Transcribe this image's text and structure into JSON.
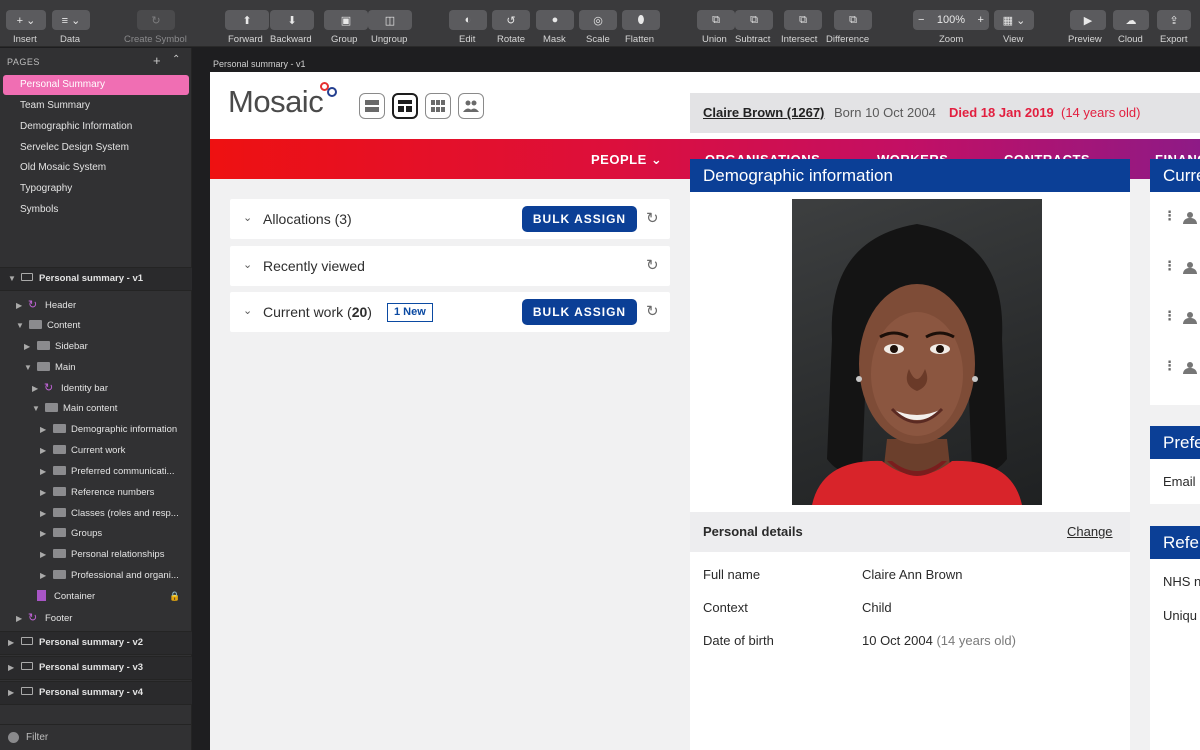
{
  "toolbar": {
    "items": [
      {
        "id": "insert",
        "label": "Insert"
      },
      {
        "id": "data",
        "label": "Data"
      },
      {
        "id": "create_symbol",
        "label": "Create Symbol"
      },
      {
        "id": "forward",
        "label": "Forward"
      },
      {
        "id": "backward",
        "label": "Backward"
      },
      {
        "id": "group",
        "label": "Group"
      },
      {
        "id": "ungroup",
        "label": "Ungroup"
      },
      {
        "id": "edit",
        "label": "Edit"
      },
      {
        "id": "rotate",
        "label": "Rotate"
      },
      {
        "id": "mask",
        "label": "Mask"
      },
      {
        "id": "scale",
        "label": "Scale"
      },
      {
        "id": "flatten",
        "label": "Flatten"
      },
      {
        "id": "union",
        "label": "Union"
      },
      {
        "id": "subtract",
        "label": "Subtract"
      },
      {
        "id": "intersect",
        "label": "Intersect"
      },
      {
        "id": "difference",
        "label": "Difference"
      },
      {
        "id": "zoom",
        "label": "Zoom"
      },
      {
        "id": "view",
        "label": "View"
      },
      {
        "id": "preview",
        "label": "Preview"
      },
      {
        "id": "cloud",
        "label": "Cloud"
      },
      {
        "id": "export",
        "label": "Export"
      }
    ],
    "zoom_value": "100%",
    "zoom_minus": "−",
    "zoom_plus": "+"
  },
  "sidebar": {
    "pages_heading": "PAGES",
    "pages": [
      "Personal Summary",
      "Team Summary",
      "Demographic Information",
      "Servelec Design System",
      "Old Mosaic System",
      "Typography",
      "Symbols"
    ],
    "active_page": "Personal Summary",
    "layers": [
      "Personal summary - v1",
      "Header",
      "Content",
      "Sidebar",
      "Main",
      "Identity bar",
      "Main content",
      "Demographic information",
      "Current work",
      "Preferred communicati...",
      "Reference numbers",
      "Classes (roles and resp...",
      "Groups",
      "Personal relationships",
      "Professional and organi...",
      "Container",
      "Footer",
      "Personal summary - v2",
      "Personal summary - v3",
      "Personal summary - v4"
    ],
    "filter_label": "Filter"
  },
  "canvas": {
    "artboard_label": "Personal summary - v1"
  },
  "app": {
    "logo_text": "Mosaic",
    "nav": [
      "PEOPLE",
      "ORGANISATIONS",
      "WORKERS",
      "CONTRACTS",
      "FINANC"
    ],
    "nav_chevron": "⌄"
  },
  "left_cards": [
    {
      "title": "Allocations (3)",
      "button": "BULK ASSIGN"
    },
    {
      "title": "Recently viewed"
    },
    {
      "title_prefix": "Current work (",
      "count": "20",
      "title_suffix": ")",
      "badge": "1 New",
      "button": "BULK ASSIGN"
    }
  ],
  "identity": {
    "name": "Claire Brown (1267)",
    "born": "Born 10 Oct 2004",
    "died": "Died 18 Jan 2019",
    "age": "(14 years old)"
  },
  "demographic": {
    "title": "Demographic information",
    "personal_details_title": "Personal details",
    "change_link": "Change",
    "rows": [
      {
        "label": "Full name",
        "value": "Claire Ann Brown"
      },
      {
        "label": "Context",
        "value": "Child"
      },
      {
        "label": "Date of birth",
        "value": "10 Oct 2004",
        "extra": "(14 years old)"
      }
    ]
  },
  "right_cut": {
    "current_title": "Curre",
    "preferred_title": "Prefe",
    "preferred_row": "Email",
    "reference_title": "Refe",
    "reference_rows": [
      "NHS n",
      "Uniqu"
    ]
  },
  "colors": {
    "accent_blue": "#0b3f96",
    "alert_red": "#e21f3f",
    "active_page": "#f06eb3"
  }
}
